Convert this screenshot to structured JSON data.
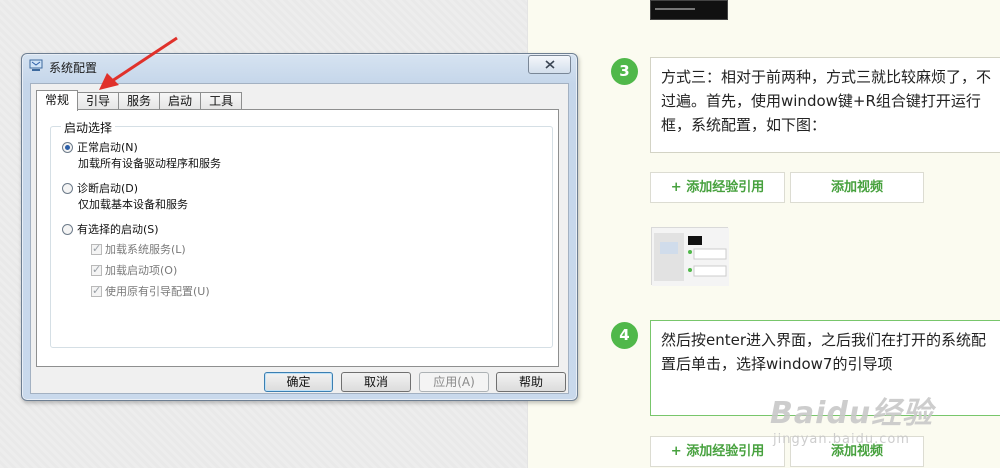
{
  "dialog": {
    "title": "系统配置",
    "tabs": [
      "常规",
      "引导",
      "服务",
      "启动",
      "工具"
    ],
    "group_label": "启动选择",
    "options": [
      {
        "label": "正常启动(N)",
        "desc": "加载所有设备驱动程序和服务",
        "checked": true
      },
      {
        "label": "诊断启动(D)",
        "desc": "仅加载基本设备和服务",
        "checked": false
      },
      {
        "label": "有选择的启动(S)",
        "desc": "",
        "checked": false
      }
    ],
    "checkboxes": [
      {
        "label": "加载系统服务(L)",
        "checked": true
      },
      {
        "label": "加载启动项(O)",
        "checked": true
      },
      {
        "label": "使用原有引导配置(U)",
        "checked": true
      }
    ],
    "buttons": {
      "ok": "确定",
      "cancel": "取消",
      "apply": "应用(A)",
      "help": "帮助"
    }
  },
  "article": {
    "step3": {
      "number": "3",
      "text": "方式三：相对于前两种，方式三就比较麻烦了，不过遍。首先，使用window键+R组合键打开运行框，系统配置，如下图："
    },
    "step4": {
      "number": "4",
      "text": "然后按enter进入界面，之后我们在打开的系统配置后单击，选择window7的引导项"
    },
    "add_ref_label": "+ 添加经验引用",
    "add_video_label": "添加视频"
  },
  "watermark": {
    "brand": "Baidu经验",
    "url": "jingyan.baidu.com"
  },
  "colors": {
    "accent_green": "#50b84a",
    "arrow_red": "#e0312b"
  }
}
